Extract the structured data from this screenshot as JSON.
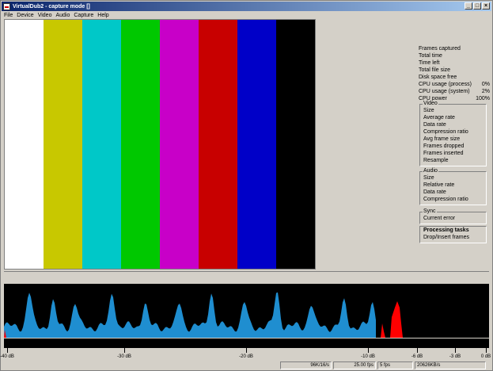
{
  "window": {
    "title": "VirtualDub2 - capture mode []"
  },
  "menu": [
    "File",
    "Device",
    "Video",
    "Audio",
    "Capture",
    "Help"
  ],
  "color_bars": [
    "#ffffff",
    "#c8c800",
    "#00c8c8",
    "#00c800",
    "#c800c8",
    "#c80000",
    "#0000c8",
    "#000000"
  ],
  "stats": [
    {
      "label": "Frames captured",
      "value": ""
    },
    {
      "label": "Total time",
      "value": ""
    },
    {
      "label": "Time left",
      "value": ""
    },
    {
      "label": "Total file size",
      "value": ""
    },
    {
      "label": "Disk space free",
      "value": ""
    },
    {
      "label": "CPU usage (process)",
      "value": "0%"
    },
    {
      "label": "CPU usage (system)",
      "value": "2%"
    },
    {
      "label": "CPU power",
      "value": "100%"
    }
  ],
  "video_group": {
    "title": "Video",
    "items": [
      "Size",
      "Average rate",
      "Data rate",
      "Compression ratio",
      "Avg frame size",
      "Frames dropped",
      "Frames inserted",
      "Resample"
    ]
  },
  "audio_group": {
    "title": "Audio",
    "items": [
      "Size",
      "Relative rate",
      "Data rate",
      "Compression ratio"
    ]
  },
  "sync_group": {
    "title": "Sync",
    "items": [
      "Current error"
    ]
  },
  "tasks_group": {
    "title": "Processing tasks",
    "items": [
      "Drop/Insert frames"
    ]
  },
  "scale_labels": [
    "-40 dB",
    "-30 dB",
    "-20 dB",
    "-10 dB",
    "-6 dB",
    "-3 dB",
    "0 dB"
  ],
  "status": {
    "audio_format": "96K/16/s",
    "fps": "25.00 fps",
    "fps2": "5 fps",
    "data_rate": "20626KB/s"
  },
  "colors": {
    "spectrum": "#1f8ed0",
    "peak": "#ff0000"
  }
}
